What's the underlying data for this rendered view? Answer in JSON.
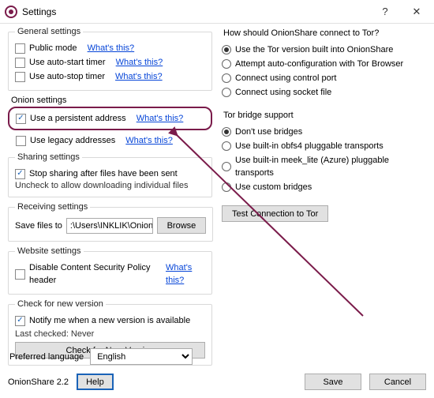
{
  "window": {
    "title": "Settings"
  },
  "general": {
    "legend": "General settings",
    "public_mode": "Public mode",
    "auto_start": "Use auto-start timer",
    "auto_stop": "Use auto-stop timer",
    "whats_this": "What's this?"
  },
  "onion": {
    "legend": "Onion settings",
    "persistent": "Use a persistent address",
    "legacy": "Use legacy addresses",
    "whats_this": "What's this?"
  },
  "sharing": {
    "legend": "Sharing settings",
    "stop_after": "Stop sharing after files have been sent",
    "note": "Uncheck to allow downloading individual files"
  },
  "receiving": {
    "legend": "Receiving settings",
    "save_label": "Save files to",
    "path": ":\\Users\\INKLIK\\OnionShare",
    "browse": "Browse"
  },
  "website": {
    "legend": "Website settings",
    "csp": "Disable Content Security Policy header",
    "whats_this": "What's this?"
  },
  "update": {
    "legend": "Check for new version",
    "notify": "Notify me when a new version is available",
    "last_checked": "Last checked: Never",
    "button": "Check for New Version"
  },
  "tor": {
    "headline": "How should OnionShare connect to Tor?",
    "opt_builtin": "Use the Tor version built into OnionShare",
    "opt_browser": "Attempt auto-configuration with Tor Browser",
    "opt_control": "Connect using control port",
    "opt_socket": "Connect using socket file"
  },
  "bridge": {
    "headline": "Tor bridge support",
    "none": "Don't use bridges",
    "obfs4": "Use built-in obfs4 pluggable transports",
    "meek": "Use built-in meek_lite (Azure) pluggable transports",
    "custom": "Use custom bridges"
  },
  "tor_test": "Test Connection to Tor",
  "language": {
    "label": "Preferred language",
    "value": "English"
  },
  "footer": {
    "version": "OnionShare 2.2",
    "help": "Help",
    "save": "Save",
    "cancel": "Cancel"
  }
}
